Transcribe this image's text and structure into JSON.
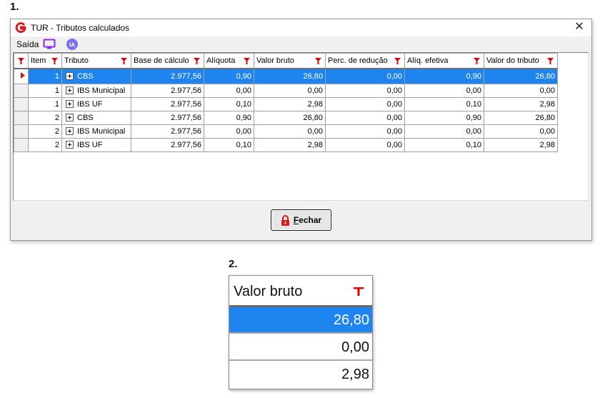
{
  "labels": {
    "panel1": "1.",
    "panel2": "2."
  },
  "window": {
    "title": "TUR - Tributos calculados",
    "close_glyph": "✕",
    "menu": {
      "saida": "Saída",
      "ia_label": "IA"
    }
  },
  "grid": {
    "columns": [
      "Item",
      "Tributo",
      "Base de cálculo",
      "Alíquota",
      "Valor bruto",
      "Perc. de redução",
      "Alíq. efetiva",
      "Valor do tributo"
    ],
    "rows": [
      {
        "item": "1",
        "tributo": "CBS",
        "base": "2.977,56",
        "aliquota": "0,90",
        "valor_bruto": "26,80",
        "perc_reducao": "0,00",
        "aliq_efetiva": "0,90",
        "valor_tributo": "26,80",
        "selected": true
      },
      {
        "item": "1",
        "tributo": "IBS Municipal",
        "base": "2.977,56",
        "aliquota": "0,00",
        "valor_bruto": "0,00",
        "perc_reducao": "0,00",
        "aliq_efetiva": "0,00",
        "valor_tributo": "0,00",
        "selected": false
      },
      {
        "item": "1",
        "tributo": "IBS UF",
        "base": "2.977,56",
        "aliquota": "0,10",
        "valor_bruto": "2,98",
        "perc_reducao": "0,00",
        "aliq_efetiva": "0,10",
        "valor_tributo": "2,98",
        "selected": false
      },
      {
        "item": "2",
        "tributo": "CBS",
        "base": "2.977,56",
        "aliquota": "0,90",
        "valor_bruto": "26,80",
        "perc_reducao": "0,00",
        "aliq_efetiva": "0,90",
        "valor_tributo": "26,80",
        "selected": false
      },
      {
        "item": "2",
        "tributo": "IBS Municipal",
        "base": "2.977,56",
        "aliquota": "0,00",
        "valor_bruto": "0,00",
        "perc_reducao": "0,00",
        "aliq_efetiva": "0,00",
        "valor_tributo": "0,00",
        "selected": false
      },
      {
        "item": "2",
        "tributo": "IBS UF",
        "base": "2.977,56",
        "aliquota": "0,10",
        "valor_bruto": "2,98",
        "perc_reducao": "0,00",
        "aliq_efetiva": "0,10",
        "valor_tributo": "2,98",
        "selected": false
      }
    ]
  },
  "footer": {
    "fechar_accel": "F",
    "fechar_rest": "echar"
  },
  "zoom": {
    "header": "Valor bruto",
    "cells": [
      "26,80",
      "0,00",
      "2,98"
    ]
  },
  "colors": {
    "selection": "#1e84ef",
    "filter_icon": "#e00000",
    "app_logo": "#d62020",
    "monitor_icon": "#8a2be2",
    "ia_badge": "#7b6cf0",
    "lock_icon": "#d81b1b"
  }
}
